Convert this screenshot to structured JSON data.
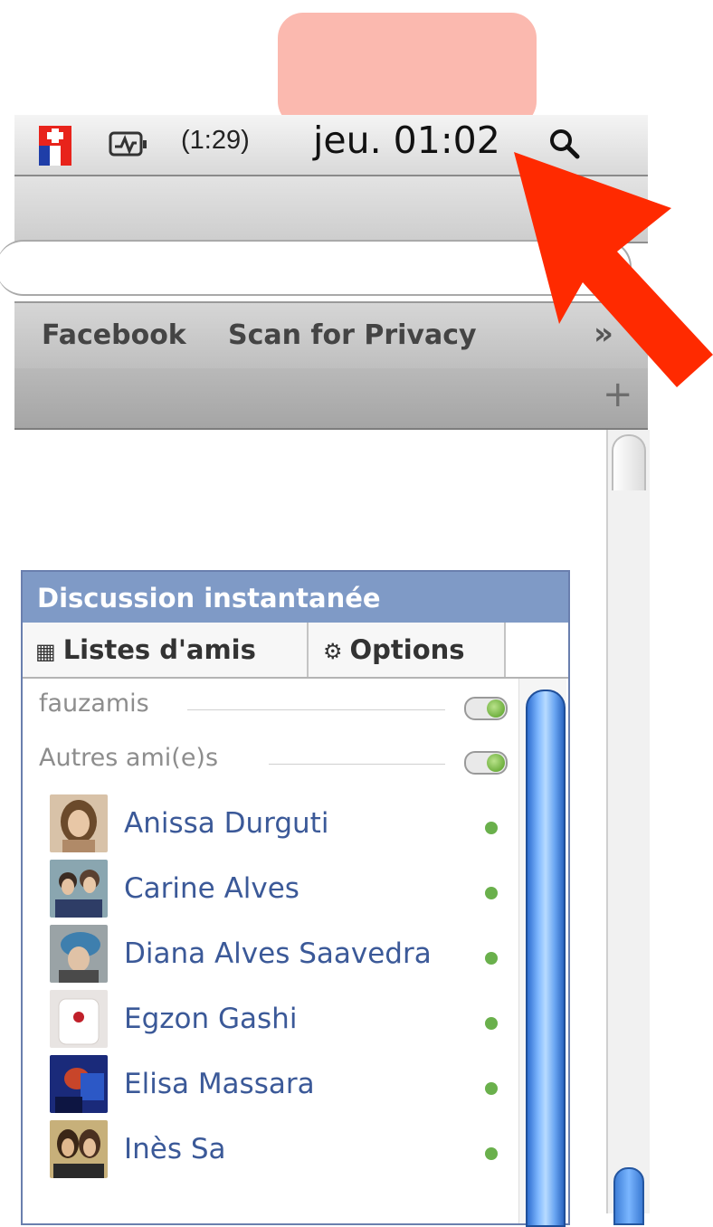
{
  "menubar": {
    "battery_time": "(1:29)",
    "clock": "jeu. 01:02",
    "icons": [
      "swiss-french-flag-icon",
      "activity-monitor-icon",
      "spotlight-search-icon"
    ]
  },
  "bookmarks": {
    "items": [
      "Facebook",
      "Scan for Privacy"
    ],
    "overflow": "»"
  },
  "tabs": {
    "new_tab": "+"
  },
  "chat": {
    "title": "Discussion instantanée",
    "tab_lists": "Listes d'amis",
    "tab_options": "Options",
    "groups": [
      "fauzamis",
      "Autres ami(e)s"
    ],
    "friends": [
      {
        "name": "Anissa Durguti",
        "status": "online"
      },
      {
        "name": "Carine Alves",
        "status": "online"
      },
      {
        "name": "Diana Alves Saavedra",
        "status": "online"
      },
      {
        "name": "Egzon Gashi",
        "status": "online"
      },
      {
        "name": "Elisa Massara",
        "status": "online"
      },
      {
        "name": "Inès Sa",
        "status": "online"
      }
    ]
  },
  "colors": {
    "facebook_blue": "#3b5998",
    "chat_header": "#7f9ac6",
    "online_dot": "#6ab04c",
    "arrow": "#ff2a00",
    "callout": "#fbb9af"
  }
}
